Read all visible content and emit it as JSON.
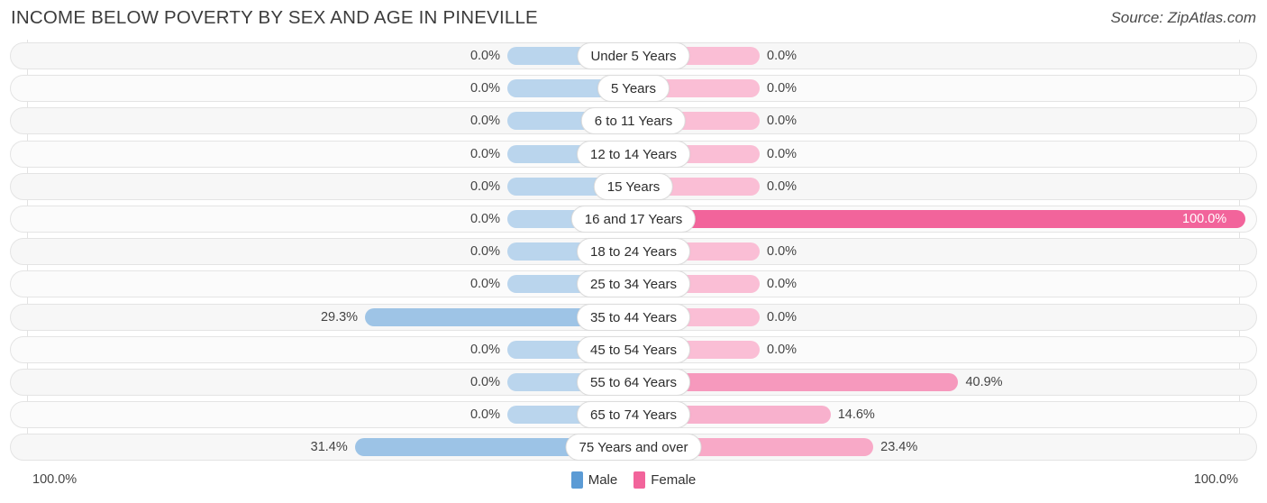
{
  "header": {
    "title": "INCOME BELOW POVERTY BY SEX AND AGE IN PINEVILLE",
    "source": "Source: ZipAtlas.com"
  },
  "footer": {
    "axis_min_label": "100.0%",
    "axis_max_label": "100.0%",
    "legend": [
      {
        "label": "Male",
        "color": "#5b9bd5",
        "swatch": "male-swatch"
      },
      {
        "label": "Female",
        "color": "#f2649b",
        "swatch": "female-swatch"
      }
    ]
  },
  "chart_data": {
    "type": "bar",
    "title": "INCOME BELOW POVERTY BY SEX AND AGE IN PINEVILLE",
    "subtitle": "",
    "xlabel": "",
    "ylabel": "",
    "orientation": "horizontal-diverging",
    "grid": true,
    "legend_position": "bottom-center",
    "xlim": [
      -100,
      100
    ],
    "axis_tick_labels": [
      "100.0%",
      "100.0%"
    ],
    "categories": [
      "Under 5 Years",
      "5 Years",
      "6 to 11 Years",
      "12 to 14 Years",
      "15 Years",
      "16 and 17 Years",
      "18 to 24 Years",
      "25 to 34 Years",
      "35 to 44 Years",
      "45 to 54 Years",
      "55 to 64 Years",
      "65 to 74 Years",
      "75 Years and over"
    ],
    "series": [
      {
        "name": "Male",
        "color": "#5b9bd5",
        "values": [
          0.0,
          0.0,
          0.0,
          0.0,
          0.0,
          0.0,
          0.0,
          0.0,
          29.3,
          0.0,
          0.0,
          0.0,
          31.4
        ],
        "labels": [
          "0.0%",
          "0.0%",
          "0.0%",
          "0.0%",
          "0.0%",
          "0.0%",
          "0.0%",
          "0.0%",
          "29.3%",
          "0.0%",
          "0.0%",
          "0.0%",
          "31.4%"
        ]
      },
      {
        "name": "Female",
        "color": "#f2649b",
        "values": [
          0.0,
          0.0,
          0.0,
          0.0,
          0.0,
          100.0,
          0.0,
          0.0,
          0.0,
          0.0,
          40.9,
          14.6,
          23.4
        ],
        "labels": [
          "0.0%",
          "0.0%",
          "0.0%",
          "0.0%",
          "0.0%",
          "100.0%",
          "0.0%",
          "0.0%",
          "0.0%",
          "0.0%",
          "40.9%",
          "14.6%",
          "23.4%"
        ]
      }
    ]
  }
}
